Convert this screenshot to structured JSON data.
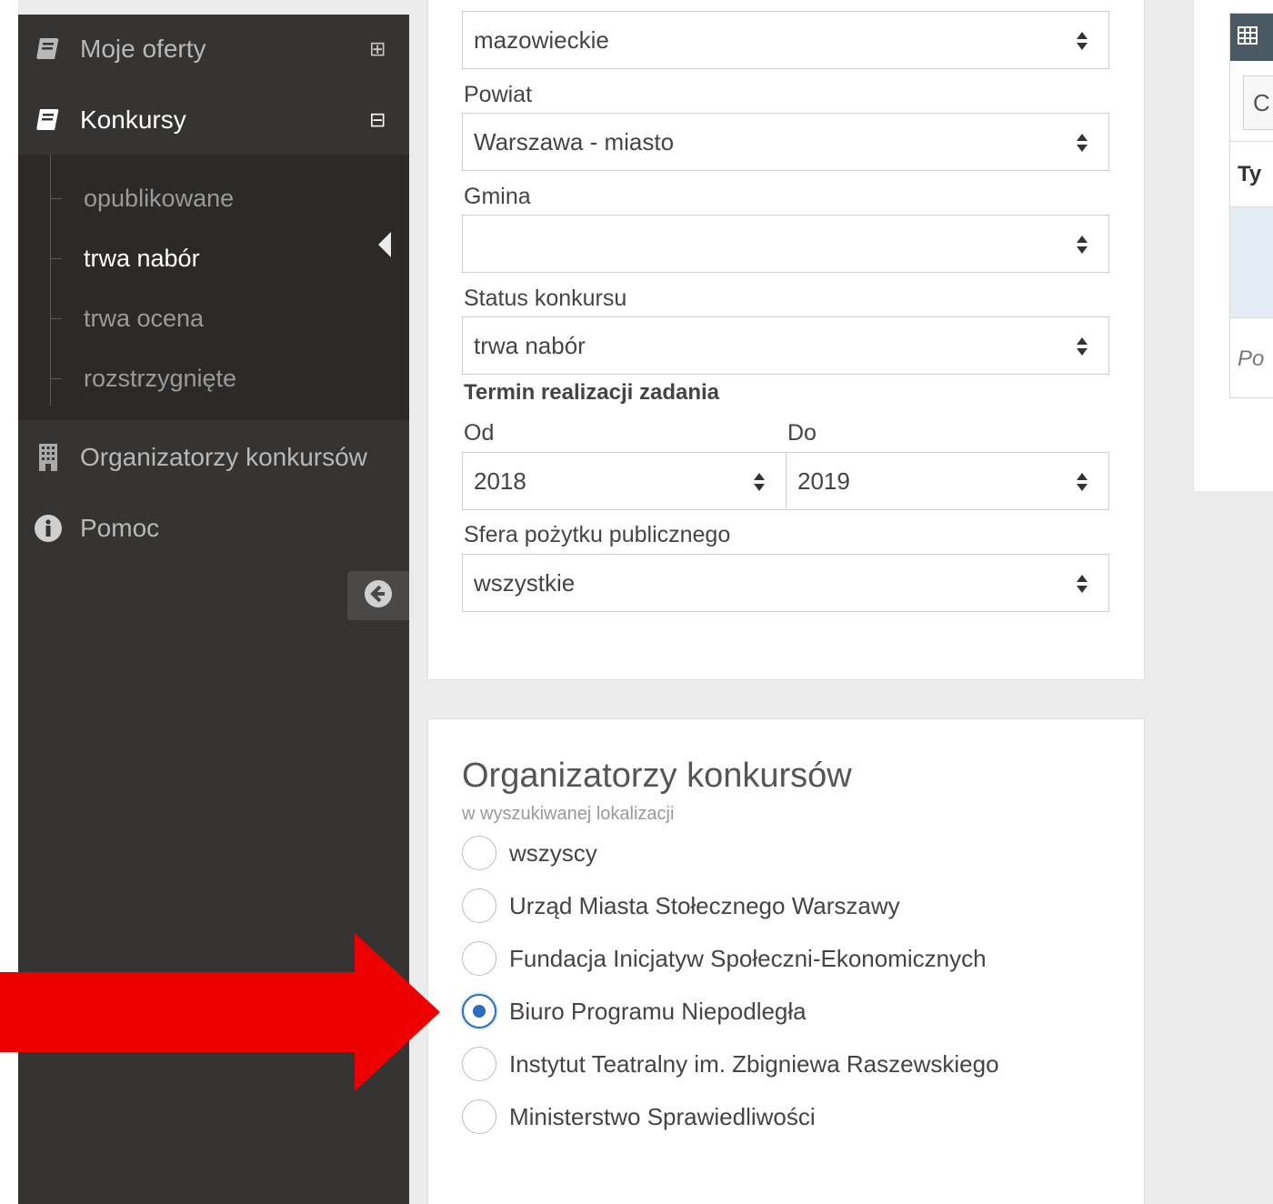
{
  "sidebar": {
    "items": [
      {
        "label": "Moje oferty",
        "icon": "book-icon",
        "toggle": "⊞"
      },
      {
        "label": "Konkursy",
        "icon": "book-icon",
        "toggle": "⊟"
      },
      {
        "label": "Organizatorzy konkursów",
        "icon": "building-icon"
      },
      {
        "label": "Pomoc",
        "icon": "info-icon"
      }
    ],
    "submenu": [
      {
        "label": "opublikowane"
      },
      {
        "label": "trwa nabór"
      },
      {
        "label": "trwa ocena"
      },
      {
        "label": "rozstrzygnięte"
      }
    ],
    "active_submenu": "trwa nabór",
    "collapse_icon": "arrow-left-circle-icon"
  },
  "filters": {
    "wojewodztwo_value": "mazowieckie",
    "powiat_label": "Powiat",
    "powiat_value": "Warszawa - miasto",
    "gmina_label": "Gmina",
    "gmina_value": "",
    "status_label": "Status konkursu",
    "status_value": "trwa nabór",
    "termin_label": "Termin realizacji zadania",
    "od_label": "Od",
    "od_value": "2018",
    "do_label": "Do",
    "do_value": "2019",
    "sfera_label": "Sfera pożytku publicznego",
    "sfera_value": "wszystkie"
  },
  "organizers": {
    "title": "Organizatorzy konkursów",
    "subtitle": "w wyszukiwanej lokalizacji",
    "options": [
      {
        "label": "wszyscy",
        "checked": false
      },
      {
        "label": "Urząd Miasta Stołecznego Warszawy",
        "checked": false
      },
      {
        "label": "Fundacja Inicjatyw Społeczni-Ekonomicznych",
        "checked": false
      },
      {
        "label": "Biuro Programu Niepodległa",
        "checked": true
      },
      {
        "label": "Instytut Teatralny im. Zbigniewa Raszewskiego",
        "checked": false
      },
      {
        "label": "Ministerstwo Sprawiedliwości",
        "checked": false
      }
    ]
  },
  "right_panel": {
    "header_icon": "table-icon",
    "button_text": "C",
    "column_header": "Ty",
    "footer_text": "Po"
  },
  "annotation": {
    "arrow_color": "#ee0000"
  },
  "colors": {
    "sidebar_bg": "#353433",
    "accent": "#2a6fbb"
  }
}
